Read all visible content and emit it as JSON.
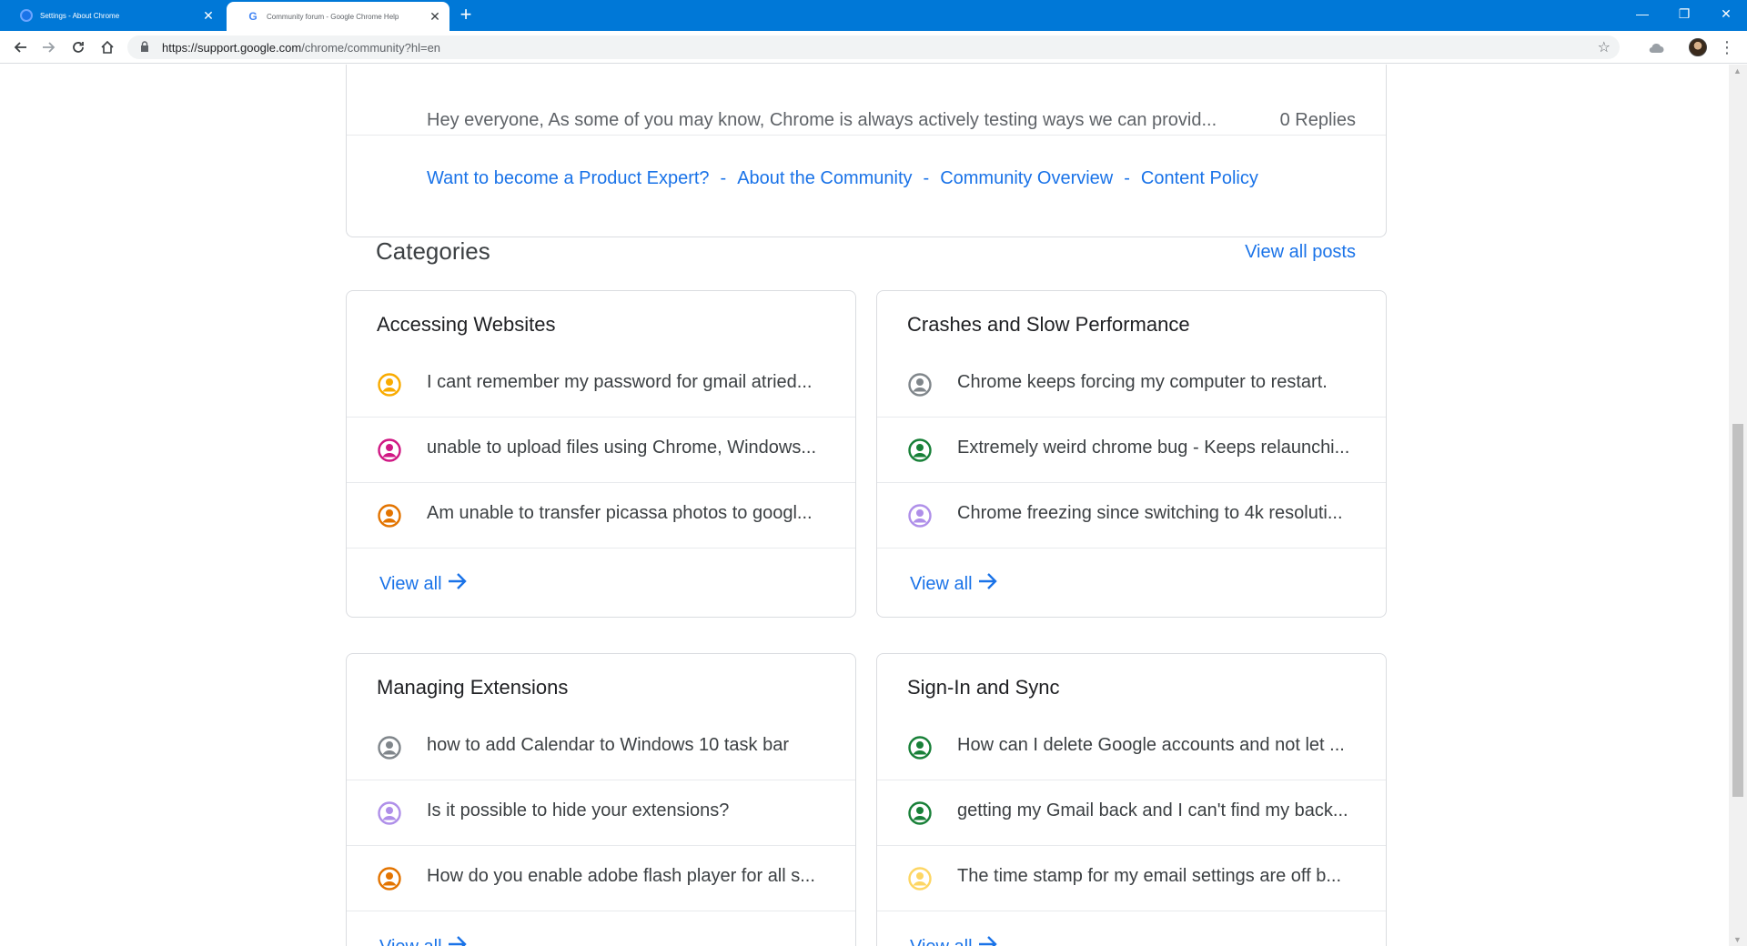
{
  "browser": {
    "tabs": [
      {
        "title": "Settings - About Chrome"
      },
      {
        "title": "Community forum - Google Chrome Help"
      }
    ],
    "new_tab": "+",
    "url_host": "https://support.google.com",
    "url_path": "/chrome/community?hl=en"
  },
  "top_card": {
    "snippet": "Hey everyone, As some of you may know, Chrome is always actively testing ways we can provid...",
    "replies": "0 Replies",
    "links": [
      "Want to become a Product Expert?",
      "About the Community",
      "Community Overview",
      "Content Policy"
    ],
    "separator": "-"
  },
  "categories": {
    "title": "Categories",
    "view_all_posts": "View all posts",
    "view_all": "View all",
    "cards": [
      {
        "name": "Accessing Websites",
        "posts": [
          {
            "text": "I cant remember my password for gmail atried...",
            "color": "#f9ab00"
          },
          {
            "text": "unable to upload files using Chrome, Windows...",
            "color": "#d01884"
          },
          {
            "text": "Am unable to transfer picassa photos to googl...",
            "color": "#e37400"
          }
        ]
      },
      {
        "name": "Crashes and Slow Performance",
        "posts": [
          {
            "text": "Chrome keeps forcing my computer to restart.",
            "color": "#80868b"
          },
          {
            "text": "Extremely weird chrome bug - Keeps relaunchi...",
            "color": "#188038"
          },
          {
            "text": "Chrome freezing since switching to 4k resoluti...",
            "color": "#af8fe9"
          }
        ]
      },
      {
        "name": "Managing Extensions",
        "posts": [
          {
            "text": "how to add Calendar to Windows 10 task bar",
            "color": "#80868b"
          },
          {
            "text": "Is it possible to hide your extensions?",
            "color": "#af8fe9"
          },
          {
            "text": "How do you enable adobe flash player for all s...",
            "color": "#e37400"
          }
        ]
      },
      {
        "name": "Sign-In and Sync",
        "posts": [
          {
            "text": "How can I delete Google accounts and not let ...",
            "color": "#188038"
          },
          {
            "text": "getting my Gmail back and I can't find my back...",
            "color": "#188038"
          },
          {
            "text": "The time stamp for my email settings are off b...",
            "color": "#fdd663"
          }
        ]
      }
    ]
  }
}
